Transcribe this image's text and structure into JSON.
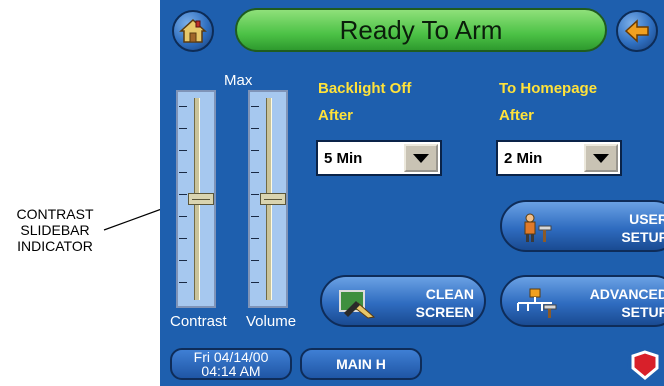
{
  "callout": {
    "lines": [
      "CONTRAST",
      "SLIDEBAR",
      "INDICATOR"
    ]
  },
  "header": {
    "title": "Ready To Arm"
  },
  "sliders": {
    "max_label": "Max",
    "contrast_label": "Contrast",
    "volume_label": "Volume",
    "contrast_level": 0.5,
    "volume_level": 0.5
  },
  "backlight": {
    "label_line1": "Backlight Off",
    "label_line2": "After",
    "value": "5 Min"
  },
  "homepage": {
    "label_line1": "To Homepage",
    "label_line2": "After",
    "value": "2 Min"
  },
  "buttons": {
    "user_setup": [
      "USER",
      "SETUP"
    ],
    "clean_screen": [
      "CLEAN",
      "SCREEN"
    ],
    "advanced_setup": [
      "ADVANCED",
      "SETUP"
    ]
  },
  "footer": {
    "date": "Fri 04/14/00",
    "time": "04:14 AM",
    "main_label": "MAIN H"
  },
  "colors": {
    "screen_bg": "#1e5fae",
    "title_green": "#4cc246",
    "label_yellow": "#ffe23a"
  }
}
